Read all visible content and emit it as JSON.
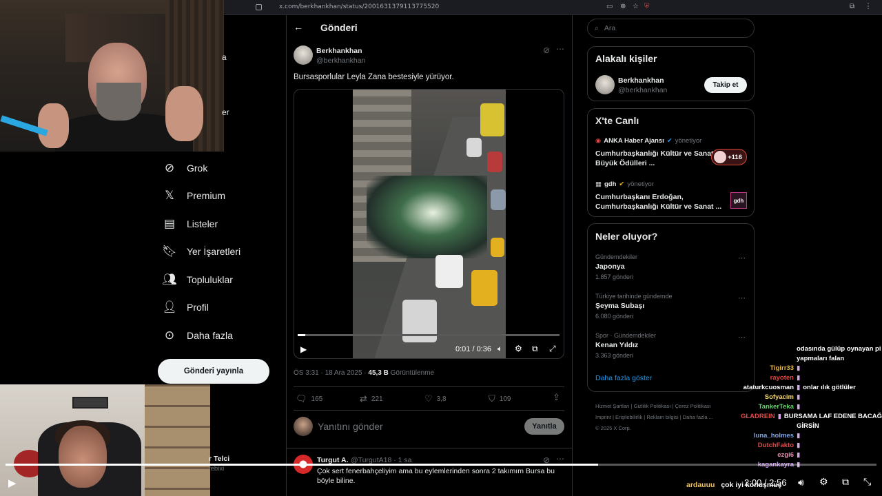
{
  "browser": {
    "url": "x.com/berkhankhan/status/2001631379113775520"
  },
  "nav": {
    "partial_a": "a",
    "partial_er": "er",
    "items": [
      {
        "label": "Grok",
        "icon": "grok-icon"
      },
      {
        "label": "Premium",
        "icon": "x-logo-icon"
      },
      {
        "label": "Listeler",
        "icon": "list-icon"
      },
      {
        "label": "Yer İşaretleri",
        "icon": "bookmark-icon"
      },
      {
        "label": "Topluluklar",
        "icon": "communities-icon"
      },
      {
        "label": "Profil",
        "icon": "profile-icon"
      },
      {
        "label": "Daha fazla",
        "icon": "more-circle-icon"
      }
    ],
    "post_button": "Gönderi yayınla",
    "account_partial_name": "r Telci",
    "account_partial_handle": "tebixi"
  },
  "post": {
    "header_title": "Gönderi",
    "author_name": "Berkhankhan",
    "author_handle": "@berkhankhan",
    "text": "Bursasporlular Leyla Zana bestesiyle yürüyor.",
    "video_time": "0:01 / 0:36",
    "video_progress_fraction": 0.03,
    "timestamp": "ÖS 3:31 · 18 Ara 2025 ·",
    "views_value": "45,3 B",
    "views_label": "Görüntülenme",
    "stats": {
      "replies": "165",
      "reposts": "221",
      "likes": "3,8",
      "bookmarks": "109"
    },
    "reply_placeholder": "Yanıtını gönder",
    "reply_button": "Yanıtla"
  },
  "reply": {
    "name": "Turgut A.",
    "handle": "@TurgutA18 · 1 sa",
    "text": "Çok sert fenerbahçeliyim ama bu eylemlerinden sonra 2 takımım Bursa bu böyle biline."
  },
  "sidebar": {
    "search_placeholder": "Ara",
    "related_title": "Alakalı kişiler",
    "related_name": "Berkhankhan",
    "related_handle": "@berkhankhan",
    "follow_button": "Takip et",
    "live_title": "X'te Canlı",
    "live": [
      {
        "source": "ANKA Haber Ajansı",
        "role": "yönetiyor",
        "title": "Cumhurbaşkanlığı Kültür ve Sanat Büyük Ödülleri ...",
        "badge": "+116"
      },
      {
        "source": "gdh",
        "role": "yönetiyor",
        "title": "Cumhurbaşkanı Erdoğan, Cumhurbaşkanlığı Kültür ve Sanat ...",
        "badge": "gdh"
      }
    ],
    "trends_title": "Neler oluyor?",
    "trends": [
      {
        "meta": "Gündemdekiler",
        "name": "Japonya",
        "count": "1.857 gönderi"
      },
      {
        "meta": "Türkiye tarihinde gündemde",
        "name": "Şeyma Subaşı",
        "count": "6.080 gönderi"
      },
      {
        "meta": "Spor · Gündemdekiler",
        "name": "Kenan Yıldız",
        "count": "3.363 gönderi"
      }
    ],
    "show_more": "Daha fazla göster",
    "footer": [
      "Hizmet Şartları",
      "Gizlilik Politikası",
      "Çerez Politikası",
      "Imprint",
      "Erişilebilirlik",
      "Reklam bilgisi",
      "Daha fazla ...",
      "© 2025 X Corp."
    ]
  },
  "chat": {
    "lines": [
      {
        "user": "",
        "msg": "odasında gülüp oynayan pi",
        "color": "#ffffff"
      },
      {
        "user": "",
        "msg": "yapmaları falan",
        "color": "#ffffff"
      },
      {
        "user": "Tigirr33",
        "msg": "",
        "color": "#e8b84a"
      },
      {
        "user": "rayoten",
        "msg": "",
        "color": "#e0453f"
      },
      {
        "user": "ataturkcuosman",
        "msg": "onlar ılık götlüler",
        "color": "#ffffff"
      },
      {
        "user": "Sofyacim",
        "msg": "",
        "color": "#f5d76e"
      },
      {
        "user": "TankerTeka",
        "msg": "",
        "color": "#66d16e"
      },
      {
        "user": "GLADREIN",
        "msg": "BURSAMA LAF EDENE BACAĞ",
        "color": "#e04a4a"
      },
      {
        "user": "",
        "msg": "GİRSİN",
        "color": "#ffffff"
      },
      {
        "user": "luna_holmes",
        "msg": "",
        "color": "#7fa7e8"
      },
      {
        "user": "DutchFakto",
        "msg": "",
        "color": "#e04a4a"
      },
      {
        "user": "ezgi6",
        "msg": "",
        "color": "#e88ab0"
      },
      {
        "user": "kagankayra",
        "msg": "",
        "color": "#c79ae8"
      }
    ],
    "bottom_user": "ardauuu",
    "bottom_msg": "çok iyi konuşmuş"
  },
  "player": {
    "timecode": "2:00 / 2:56",
    "progress_fraction": 0.68
  }
}
